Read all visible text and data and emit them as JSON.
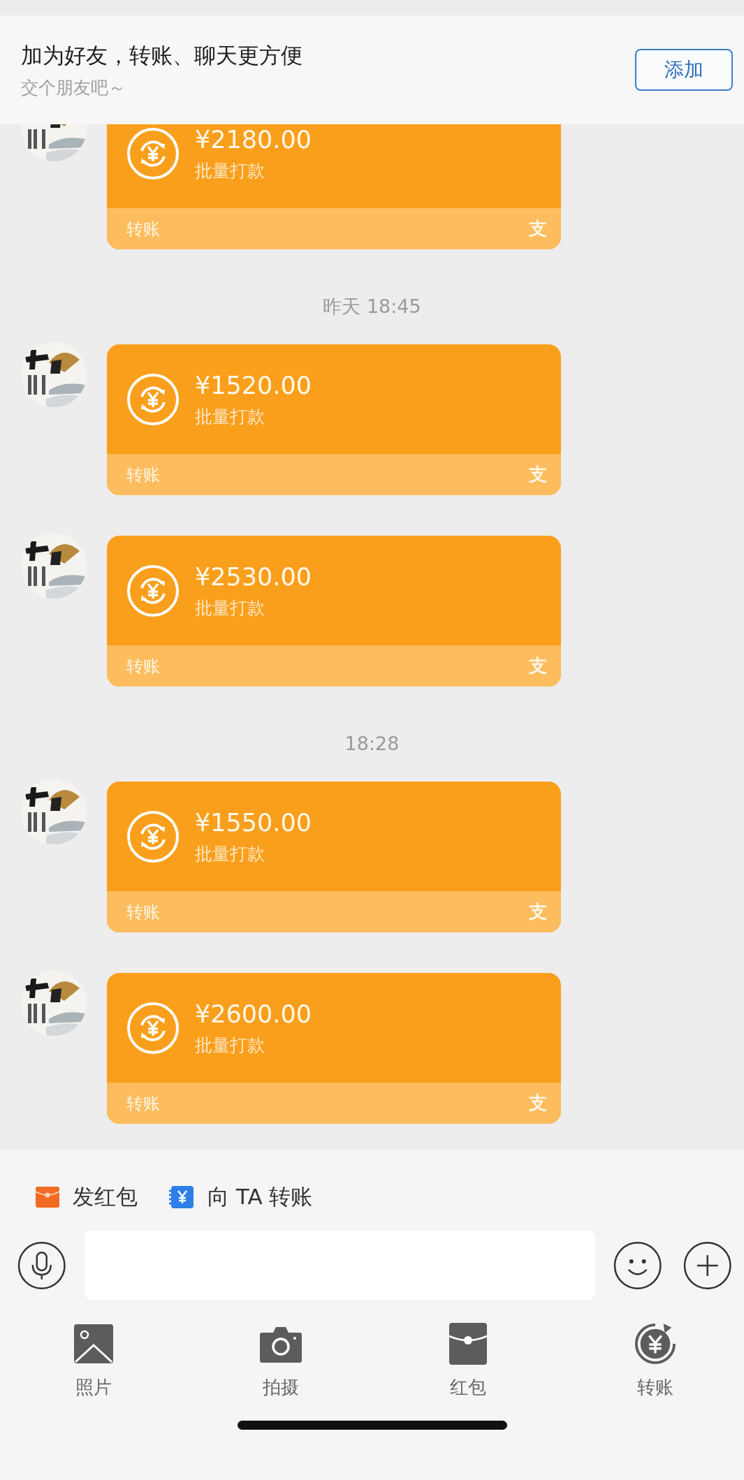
{
  "banner": {
    "title": "加为好友，转账、聊天更方便",
    "subtitle": "交个朋友吧～",
    "button": "添加"
  },
  "messages": [
    {
      "kind": "transfer",
      "amount": "¥2180.00",
      "note": "批量打款",
      "footer": "转账",
      "logo": "支"
    },
    {
      "kind": "time",
      "text": "昨天 18:45"
    },
    {
      "kind": "transfer",
      "amount": "¥1520.00",
      "note": "批量打款",
      "footer": "转账",
      "logo": "支"
    },
    {
      "kind": "transfer",
      "amount": "¥2530.00",
      "note": "批量打款",
      "footer": "转账",
      "logo": "支"
    },
    {
      "kind": "time",
      "text": "18:28"
    },
    {
      "kind": "transfer",
      "amount": "¥1550.00",
      "note": "批量打款",
      "footer": "转账",
      "logo": "支"
    },
    {
      "kind": "transfer",
      "amount": "¥2600.00",
      "note": "批量打款",
      "footer": "转账",
      "logo": "支"
    }
  ],
  "quick_actions": [
    {
      "kind": "red-packet",
      "label": "发红包"
    },
    {
      "kind": "transfer",
      "label": "向 TA 转账"
    }
  ],
  "tools": [
    {
      "label": "照片"
    },
    {
      "kind": "camera",
      "label": "拍摄"
    },
    {
      "kind": "red-packet",
      "label": "红包"
    },
    {
      "kind": "transfer",
      "label": "转账"
    }
  ]
}
